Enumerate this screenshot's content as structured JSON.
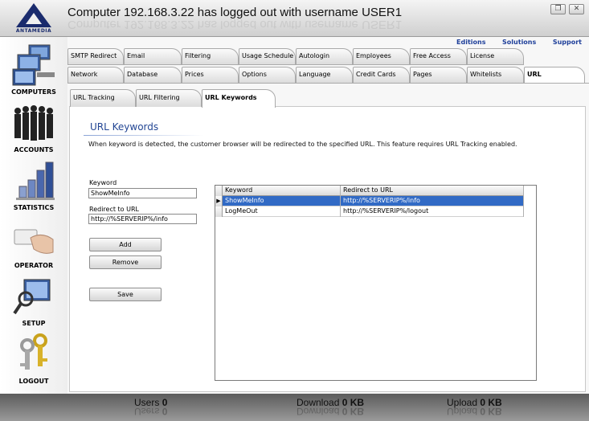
{
  "window": {
    "title": "Computer 192.168.3.22 has logged out with username USER1",
    "logo_text": "ANTAMEDIA",
    "minimize_glyph": "❐",
    "close_glyph": "✕"
  },
  "sidebar": {
    "items": [
      {
        "label": "COMPUTERS",
        "icon": "computers-icon"
      },
      {
        "label": "ACCOUNTS",
        "icon": "accounts-icon"
      },
      {
        "label": "STATISTICS",
        "icon": "statistics-icon"
      },
      {
        "label": "OPERATOR",
        "icon": "operator-icon"
      },
      {
        "label": "SETUP",
        "icon": "setup-icon"
      },
      {
        "label": "LOGOUT",
        "icon": "logout-icon"
      }
    ]
  },
  "top_links": [
    "Editions",
    "Solutions",
    "Support"
  ],
  "tabs_row1": [
    "SMTP Redirect",
    "Email",
    "Filtering",
    "Usage Schedule",
    "Autologin",
    "Employees",
    "Free Access",
    "License"
  ],
  "tabs_row2": [
    "Network",
    "Database",
    "Prices",
    "Options",
    "Language",
    "Credit Cards",
    "Pages",
    "Whitelists",
    "URL"
  ],
  "active_tab": "URL",
  "subtabs": [
    "URL Tracking",
    "URL Filtering",
    "URL Keywords"
  ],
  "active_subtab": "URL Keywords",
  "page": {
    "heading": "URL Keywords",
    "description": "When keyword is detected, the customer browser will be redirected to the specified URL. This feature requires URL Tracking enabled.",
    "keyword_label": "Keyword",
    "keyword_value": "ShowMeInfo",
    "redirect_label": "Redirect to URL",
    "redirect_value": "http://%SERVERIP%/info",
    "add_label": "Add",
    "remove_label": "Remove",
    "save_label": "Save"
  },
  "table": {
    "columns": [
      "Keyword",
      "Redirect to URL"
    ],
    "rows": [
      {
        "keyword": "ShowMeInfo",
        "url": "http://%SERVERIP%/info",
        "selected": true
      },
      {
        "keyword": "LogMeOut",
        "url": "http://%SERVERIP%/logout",
        "selected": false
      }
    ]
  },
  "status": {
    "users_label": "Users",
    "users_value": "0",
    "download_label": "Download",
    "download_value": "0 KB",
    "upload_label": "Upload",
    "upload_value": "0 KB"
  },
  "colors": {
    "accent": "#234694",
    "link": "#1e3f9a",
    "selection": "#316ac5"
  }
}
